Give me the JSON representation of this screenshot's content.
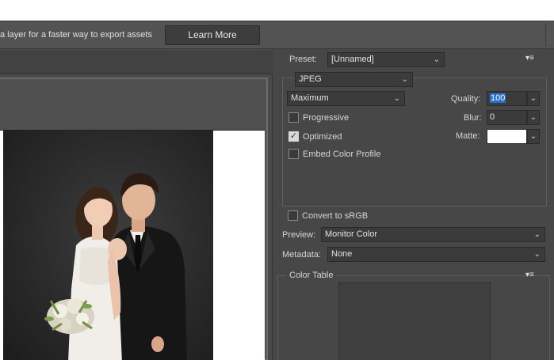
{
  "tipbar": {
    "text": "a layer for a faster way to export assets",
    "learn_more": "Learn More"
  },
  "settings": {
    "preset_label": "Preset:",
    "preset_value": "[Unnamed]",
    "format_value": "JPEG",
    "quality_preset_value": "Maximum",
    "quality_label": "Quality:",
    "quality_value": "100",
    "blur_label": "Blur:",
    "blur_value": "0",
    "matte_label": "Matte:",
    "matte_color": "#ffffff",
    "progressive_label": "Progressive",
    "progressive_checked": false,
    "optimized_label": "Optimized",
    "optimized_checked": true,
    "embed_label": "Embed Color Profile",
    "embed_checked": false,
    "convert_label": "Convert to sRGB",
    "convert_checked": false,
    "preview_label": "Preview:",
    "preview_value": "Monitor Color",
    "metadata_label": "Metadata:",
    "metadata_value": "None",
    "color_table_label": "Color Table"
  },
  "icons": {
    "chevron": "chevron-down-icon",
    "panel_menu": "panel-menu-icon",
    "check": "checkmark-icon"
  },
  "colors": {
    "panel_bg": "#474747",
    "selection": "#2a6fc9"
  }
}
